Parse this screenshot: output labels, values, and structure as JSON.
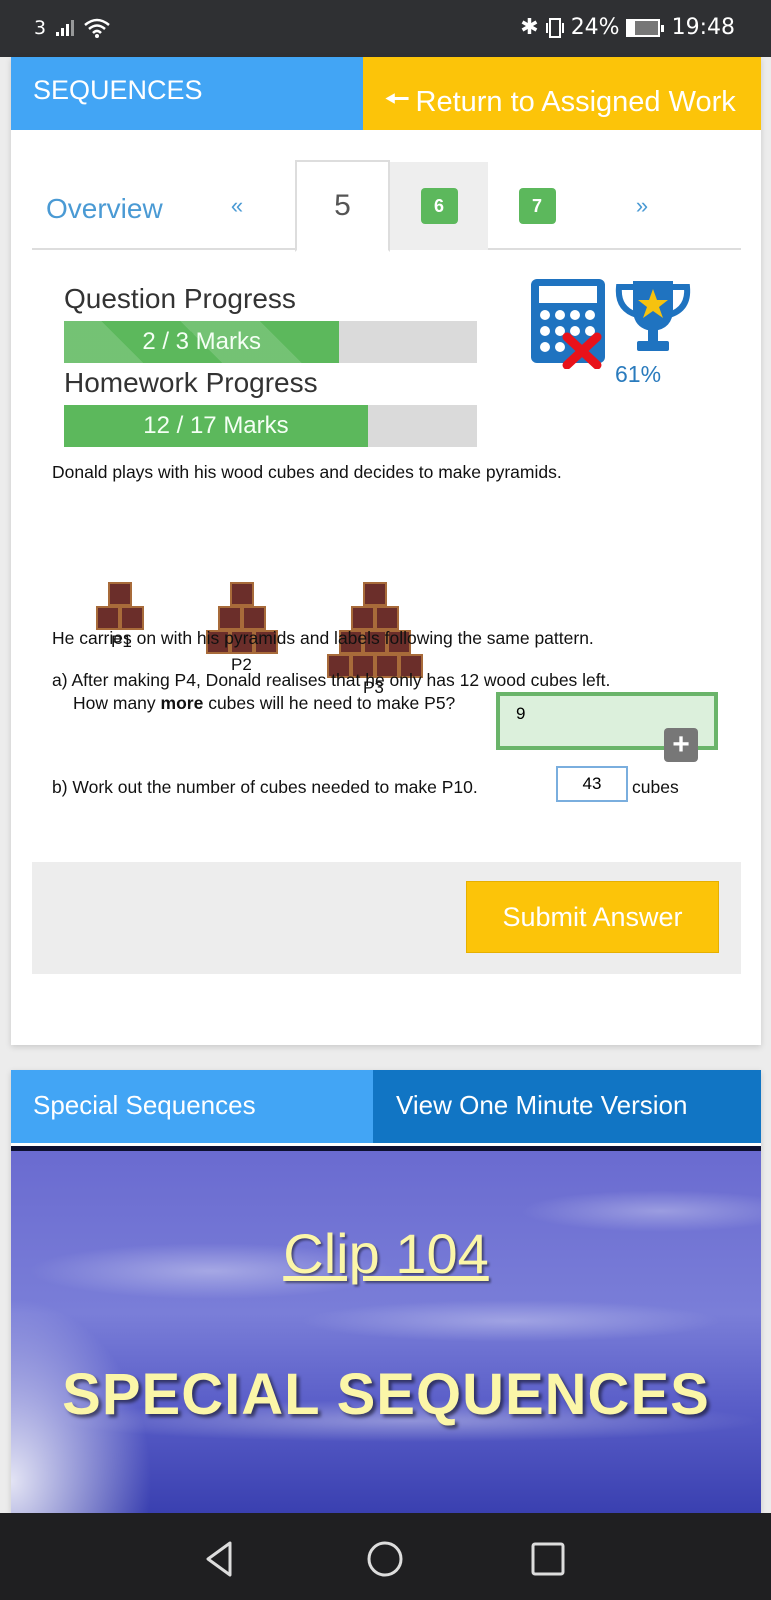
{
  "status_bar": {
    "carrier": "3",
    "battery": "24%",
    "time": "19:48",
    "icons": [
      "signal-icon",
      "wifi-icon",
      "bluetooth-icon",
      "vibrate-icon",
      "battery-charging-icon"
    ]
  },
  "header": {
    "title": "SEQUENCES",
    "return_label": "Return to Assigned Work",
    "return_icon": "arrow-left-icon"
  },
  "tabs": {
    "overview": "Overview",
    "prev": "«",
    "items": [
      {
        "label": "5",
        "state": "active"
      },
      {
        "label": "6",
        "state": "completed"
      },
      {
        "label": "7",
        "state": "completed"
      }
    ],
    "next": "»"
  },
  "progress": {
    "question": {
      "label": "Question Progress",
      "text": "2 / 3 Marks",
      "value": 2,
      "max": 3
    },
    "homework": {
      "label": "Homework Progress",
      "text": "12 / 17 Marks",
      "value": 12,
      "max": 17
    }
  },
  "stats": {
    "calculator_icon": "calculator-not-allowed-icon",
    "trophy_icon": "trophy-icon",
    "score": "61%"
  },
  "question": {
    "intro": "Donald plays with his wood cubes and decides to make pyramids.",
    "pyramids": [
      {
        "label": "P1",
        "rows": [
          1,
          2
        ]
      },
      {
        "label": "P2",
        "rows": [
          1,
          2,
          3
        ]
      },
      {
        "label": "P3",
        "rows": [
          1,
          2,
          3,
          4
        ]
      }
    ],
    "pattern_text": "He carries on with his pyramids and labels following the same pattern.",
    "part_a": {
      "line1": "a) After making P4, Donald realises that he only has 12 wood cubes left.",
      "line2_pre": "How many ",
      "line2_bold": "more",
      "line2_post": " cubes will he need to make P5?",
      "answer": "9",
      "expand_label": "+"
    },
    "part_b": {
      "text": "b) Work out the number of cubes needed to make P10.",
      "answer": "43",
      "unit": "cubes"
    }
  },
  "submit": {
    "label": "Submit Answer"
  },
  "video_section": {
    "title": "Special Sequences",
    "button": "View One Minute Version",
    "clip_number": "Clip 104",
    "clip_title": "SPECIAL SEQUENCES"
  },
  "nav": {
    "back": "back-icon",
    "home": "home-icon",
    "recents": "recents-icon"
  },
  "colors": {
    "blue": "#42a5f5",
    "dark_blue": "#1175c4",
    "yellow": "#fcc409",
    "green": "#5cb85c",
    "cube": "#6b2e2a"
  }
}
